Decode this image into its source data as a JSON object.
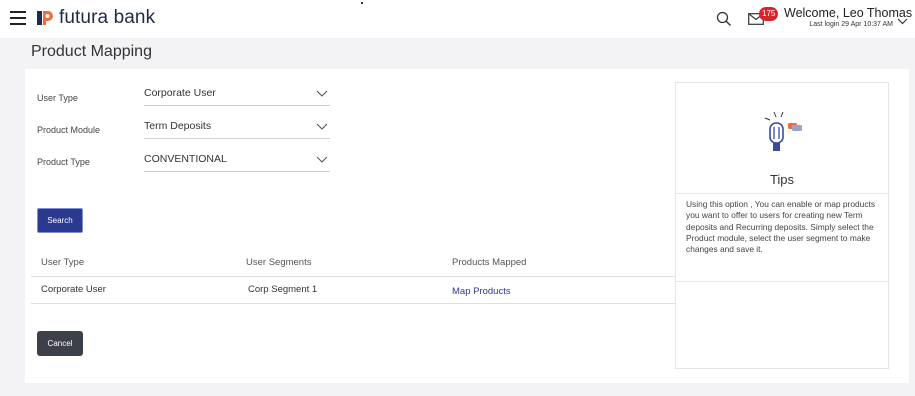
{
  "header": {
    "brand_name": "futura bank",
    "notification_count": "175",
    "welcome_text": "Welcome, Leo Thomas",
    "last_login": "Last login 29 Apr 10:37 AM"
  },
  "page": {
    "title": "Product Mapping"
  },
  "form": {
    "user_type_label": "User Type",
    "user_type_value": "Corporate User",
    "product_module_label": "Product Module",
    "product_module_value": "Term Deposits",
    "product_type_label": "Product Type",
    "product_type_value": "CONVENTIONAL",
    "search_label": "Search"
  },
  "table": {
    "columns": [
      "User Type",
      "User Segments",
      "Products Mapped"
    ],
    "rows": [
      [
        "Corporate User",
        "Corp Segment 1",
        "Map Products"
      ]
    ]
  },
  "actions": {
    "cancel_label": "Cancel"
  },
  "tips": {
    "title": "Tips",
    "text": "Using this option , You can enable or map products you want to offer to users for creating new Term deposits and Recurring deposits. Simply select the Product module, select the user segment to make changes and save it."
  },
  "colors": {
    "primary": "#2b3990",
    "cancel": "#3d4049",
    "badge": "#d8232a",
    "accent_orange": "#f26b3a"
  }
}
